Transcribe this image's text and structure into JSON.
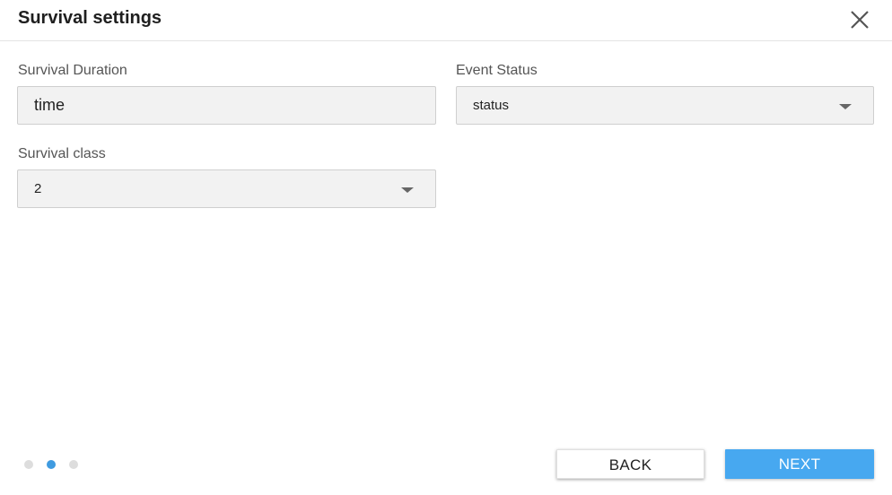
{
  "dialog": {
    "title": "Survival settings",
    "close_icon": "close-icon"
  },
  "fields": {
    "survival_duration": {
      "label": "Survival Duration",
      "value": "time"
    },
    "event_status": {
      "label": "Event Status",
      "value": "status",
      "icon": "chevron-down-icon"
    },
    "survival_class": {
      "label": "Survival class",
      "value": "2",
      "icon": "chevron-down-icon"
    }
  },
  "stepper": {
    "total_steps": 3,
    "current_step": 2,
    "active_color": "#3f9be0",
    "inactive_color": "#dddddd"
  },
  "footer": {
    "back_label": "BACK",
    "next_label": "NEXT",
    "next_color": "#47a8f0"
  }
}
